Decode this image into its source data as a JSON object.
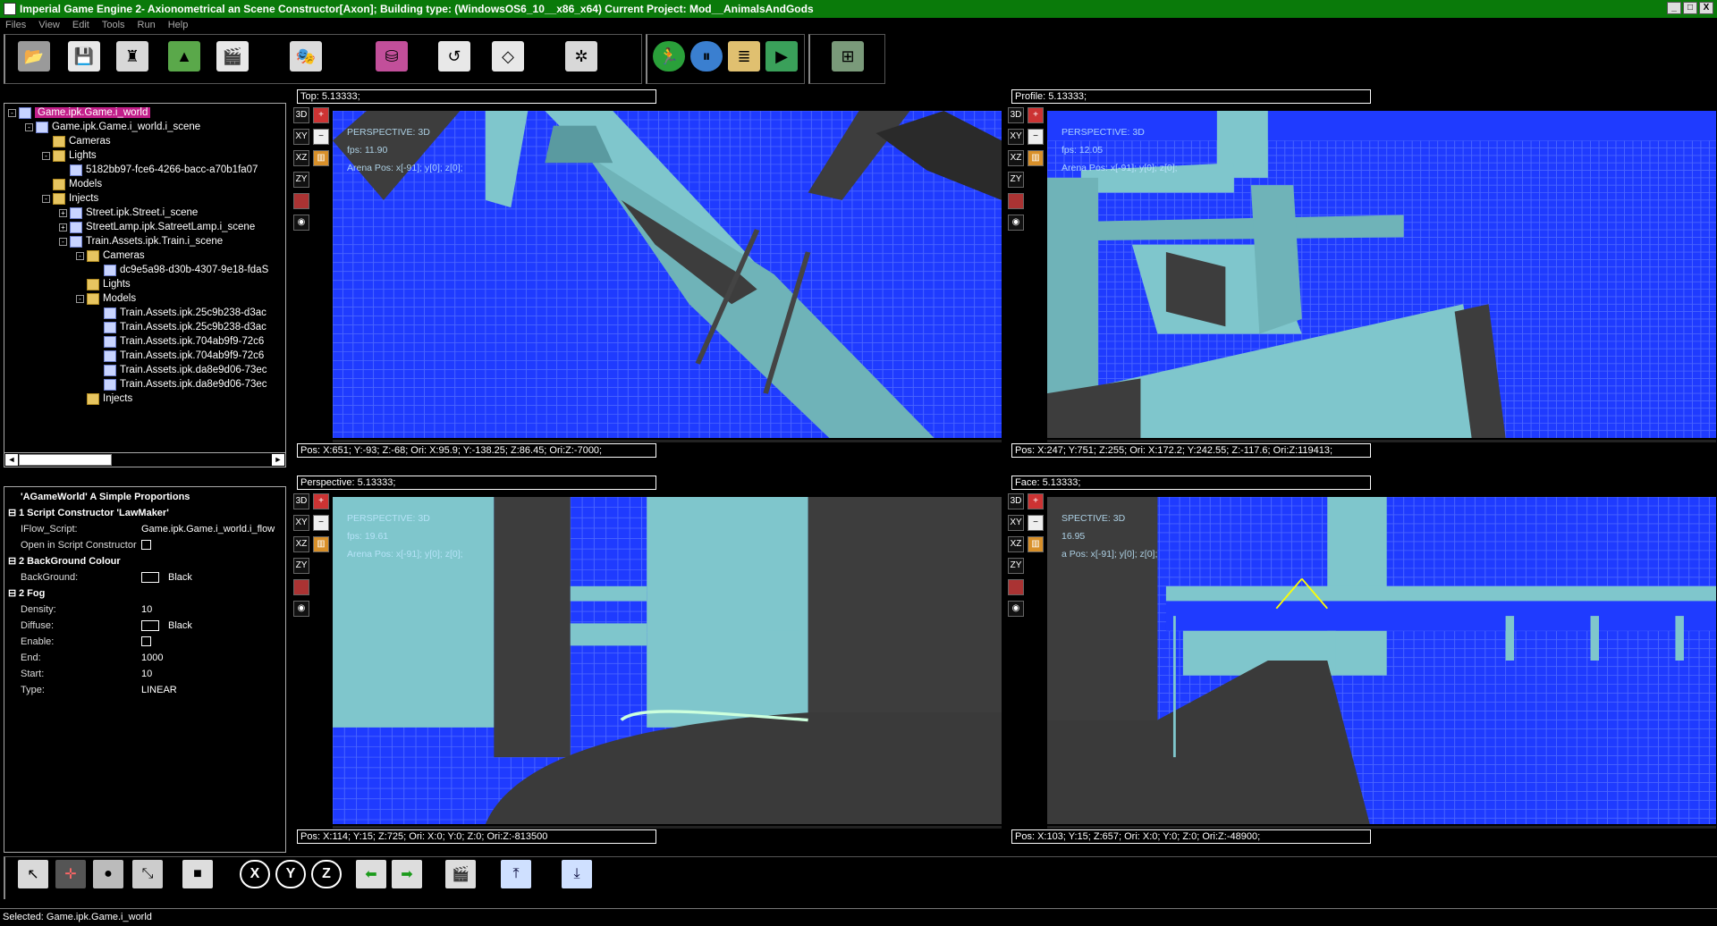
{
  "titlebar": {
    "title": "Imperial Game Engine 2- Axionometrical an Scene Constructor[Axon]; Building type: (WindowsOS6_10__x86_x64) Current Project: Mod__AnimalsAndGods"
  },
  "menu": [
    "Files",
    "View",
    "Edit",
    "Tools",
    "Run",
    "Help"
  ],
  "toolbar": {
    "icons": [
      "open-folder-icon",
      "save-disk-icon",
      "eagle-emblem-icon",
      "chart-icon",
      "clapper-icon",
      "theater-masks-icon",
      "database-icon",
      "loop-arrow-icon",
      "octahedron-icon",
      "molecule-icon",
      "run-man-icon",
      "pause-icon",
      "layers-icon",
      "eagle-play-icon",
      "network-icon"
    ]
  },
  "tree": {
    "nodes": [
      {
        "label": "Game.ipk.Game.i_world",
        "depth": 0,
        "type": "file",
        "selected": true,
        "expander": "-"
      },
      {
        "label": "Game.ipk.Game.i_world.i_scene",
        "depth": 1,
        "type": "file",
        "expander": "-"
      },
      {
        "label": "Cameras",
        "depth": 2,
        "type": "folder",
        "expander": ""
      },
      {
        "label": "Lights",
        "depth": 2,
        "type": "folder",
        "expander": "-"
      },
      {
        "label": "5182bb97-fce6-4266-bacc-a70b1fa07",
        "depth": 3,
        "type": "file",
        "expander": ""
      },
      {
        "label": "Models",
        "depth": 2,
        "type": "folder",
        "expander": ""
      },
      {
        "label": "Injects",
        "depth": 2,
        "type": "folder",
        "expander": "-"
      },
      {
        "label": "Street.ipk.Street.i_scene",
        "depth": 3,
        "type": "file",
        "expander": "+"
      },
      {
        "label": "StreetLamp.ipk.SatreetLamp.i_scene",
        "depth": 3,
        "type": "file",
        "expander": "+"
      },
      {
        "label": "Train.Assets.ipk.Train.i_scene",
        "depth": 3,
        "type": "file",
        "expander": "-"
      },
      {
        "label": "Cameras",
        "depth": 4,
        "type": "folder",
        "expander": "-"
      },
      {
        "label": "dc9e5a98-d30b-4307-9e18-fdaS",
        "depth": 5,
        "type": "file",
        "expander": ""
      },
      {
        "label": "Lights",
        "depth": 4,
        "type": "folder",
        "expander": ""
      },
      {
        "label": "Models",
        "depth": 4,
        "type": "folder",
        "expander": "-"
      },
      {
        "label": "Train.Assets.ipk.25c9b238-d3ac",
        "depth": 5,
        "type": "file",
        "expander": ""
      },
      {
        "label": "Train.Assets.ipk.25c9b238-d3ac",
        "depth": 5,
        "type": "file",
        "expander": ""
      },
      {
        "label": "Train.Assets.ipk.704ab9f9-72c6",
        "depth": 5,
        "type": "file",
        "expander": ""
      },
      {
        "label": "Train.Assets.ipk.704ab9f9-72c6",
        "depth": 5,
        "type": "file",
        "expander": ""
      },
      {
        "label": "Train.Assets.ipk.da8e9d06-73ec",
        "depth": 5,
        "type": "file",
        "expander": ""
      },
      {
        "label": "Train.Assets.ipk.da8e9d06-73ec",
        "depth": 5,
        "type": "file",
        "expander": ""
      },
      {
        "label": "Injects",
        "depth": 4,
        "type": "folder",
        "expander": ""
      }
    ],
    "scroll_left": "◄",
    "scroll_right": "►"
  },
  "props": {
    "header": "'AGameWorld' A Simple Proportions",
    "rows": [
      {
        "kind": "cat",
        "label": "1 Script Constructor 'LawMaker'"
      },
      {
        "kind": "val",
        "label": "IFlow_Script:",
        "value": "Game.ipk.Game.i_world.i_flow"
      },
      {
        "kind": "check",
        "label": "Open in Script Constructor",
        "value": ""
      },
      {
        "kind": "cat",
        "label": "2 BackGround Colour"
      },
      {
        "kind": "swatch",
        "label": "BackGround:",
        "value": "Black"
      },
      {
        "kind": "cat",
        "label": "2 Fog"
      },
      {
        "kind": "val",
        "label": "Density:",
        "value": "10"
      },
      {
        "kind": "swatch",
        "label": "Diffuse:",
        "value": "Black"
      },
      {
        "kind": "check",
        "label": "Enable:",
        "value": ""
      },
      {
        "kind": "val",
        "label": "End:",
        "value": "1000"
      },
      {
        "kind": "val",
        "label": "Start:",
        "value": "10"
      },
      {
        "kind": "val",
        "label": "Type:",
        "value": "LINEAR"
      }
    ]
  },
  "viewports": [
    {
      "id": "top",
      "name": "Top: 5.13333;",
      "pos": "Pos: X:651; Y:-93; Z:-68; Ori: X:95.9; Y:-138.25; Z:86.45; Ori:Z:-7000;",
      "overlay1": "PERSPECTIVE: 3D",
      "overlay2": "fps: 11.90",
      "overlay3": "Arena Pos: x[-91]; y[0]; z[0];"
    },
    {
      "id": "profile",
      "name": "Profile: 5.13333;",
      "pos": "Pos: X:247; Y:751; Z:255; Ori: X:172.2; Y:242.55; Z:-117.6; Ori:Z:119413;",
      "overlay1": "PERSPECTIVE: 3D",
      "overlay2": "fps: 12.05",
      "overlay3": "Arena Pos: x[-91]; y[0]; z[0];"
    },
    {
      "id": "perspective",
      "name": "Perspective: 5.13333;",
      "pos": "Pos: X:114; Y:15; Z:725; Ori: X:0; Y:0; Z:0; Ori:Z:-813500",
      "overlay1": "PERSPECTIVE: 3D",
      "overlay2": "fps: 19.61",
      "overlay3": "Arena Pos: x[-91]; y[0]; z[0];"
    },
    {
      "id": "face",
      "name": "Face: 5.13333;",
      "pos": "Pos: X:103; Y:15; Z:657; Ori: X:0; Y:0; Z:0; Ori:Z:-48900;",
      "overlay1": "SPECTIVE: 3D",
      "overlay2": "16.95",
      "overlay3": "a Pos: x[-91]; y[0]; z[0];"
    }
  ],
  "view_buttons": [
    "3D",
    "XY",
    "XZ",
    "ZY"
  ],
  "bottom_tools": {
    "icons": [
      "select-arrow-icon",
      "axis-gizmo-icon",
      "sphere-icon",
      "scale-icon",
      "square-icon",
      "x-axis-icon",
      "y-axis-icon",
      "z-axis-icon",
      "undo-arrow-icon",
      "redo-arrow-icon",
      "clapper-icon",
      "frame-top-icon",
      "frame-bottom-icon"
    ],
    "x": "X",
    "y": "Y",
    "z": "Z"
  },
  "status": "Selected: Game.ipk.Game.i_world",
  "colors": {
    "titlebar": "#0a7a0a",
    "viewport_floor": "#1f3bff",
    "model": "#7fc6cc",
    "shadow": "#3d3d3d"
  }
}
